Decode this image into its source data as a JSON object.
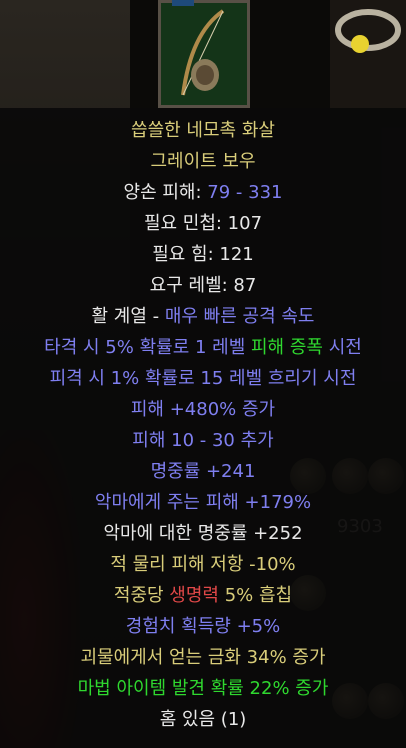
{
  "item": {
    "name": "씁쓸한 네모촉 화살",
    "base": "그레이트 보우",
    "damage_label": "양손 피해:",
    "damage_value": "79 - 331",
    "req_dex": "필요 민첩: 107",
    "req_str": "필요 힘: 121",
    "req_level": "요구 레벨: 87",
    "class_label": "활 계열 - ",
    "speed": "매우 빠른 공격 속도",
    "proc1_a": "타격 시 5% 확률로 1 레벨 ",
    "proc1_b": "피해 증폭",
    "proc1_c": " 시전",
    "proc2": "피격 시 1% 확률로 15 레벨 흐리기 시전",
    "mod_damage_pct": "피해 +480% 증가",
    "mod_damage_add": "피해 10 - 30 추가",
    "mod_ar": "명중률 +241",
    "mod_demon_dmg": "악마에게 주는 피해 +179%",
    "mod_demon_ar": "악마에 대한 명중률 +252",
    "mod_enemy_res": "적 물리 피해 저항 -10%",
    "mod_leech_a": "적중당 ",
    "mod_leech_b": "생명력",
    "mod_leech_c": " 5% 흡칩",
    "mod_exp": "경험치 획득량 +5%",
    "mod_gold": "괴물에게서 얻는 금화 34% 증가",
    "mod_mf": "마법 아이템 발견 확률 22% 증가",
    "sockets": "홈 있음 (1)"
  },
  "background": {
    "stat_number": "9303"
  },
  "colors": {
    "unique_gold": "#d9cd7a",
    "magic_blue": "#7f7ff0",
    "set_green": "#2fd82f",
    "life_red": "#e04848",
    "normal_white": "#e8e8e8"
  }
}
